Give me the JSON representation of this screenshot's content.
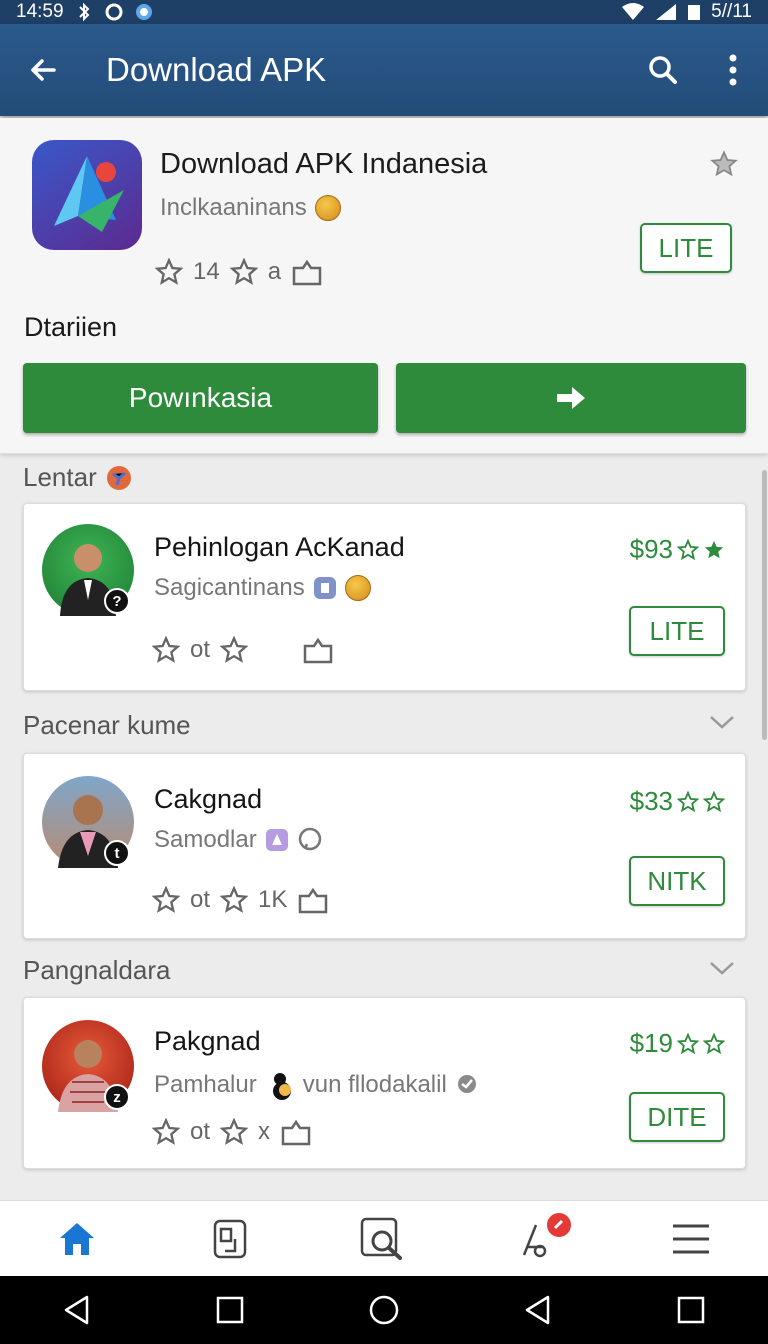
{
  "status_bar": {
    "time": "14:59",
    "right_text": "5//11"
  },
  "app_bar": {
    "title": "Download APK"
  },
  "hero": {
    "app_name": "Download APK Indanesia",
    "developer": "Inclkaaninans",
    "tag": "LITE",
    "meta": {
      "rating": "14",
      "downloads": "a"
    },
    "section_title": "Dtariien",
    "download_button": "Powınkasia"
  },
  "sections": [
    {
      "title": "Lentar"
    },
    {
      "title": "Pacenar kume"
    },
    {
      "title": "Pangnaldara"
    }
  ],
  "cards": [
    {
      "name": "Pehinlogan AcKanad",
      "developer": "Sagicantinans",
      "price": "$93",
      "tag": "LITE",
      "meta_a": "ot",
      "meta_b": "",
      "badge": "?"
    },
    {
      "name": "Cakgnad",
      "developer": "Samodlar",
      "price": "$33",
      "tag": "NITK",
      "meta_a": "ot",
      "meta_b": "1K",
      "badge": "t"
    },
    {
      "name": "Pakgnad",
      "developer": "Pamhalur",
      "developer_extra": "vun fllodakalil",
      "price": "$19",
      "tag": "DITE",
      "meta_a": "ot",
      "meta_b": "x",
      "badge": "z"
    }
  ],
  "icons": {
    "status": [
      "wifi-icon",
      "signal-icon",
      "battery-icon"
    ],
    "app_bar": [
      "back-arrow-icon",
      "search-icon",
      "more-vert-icon"
    ],
    "bottom_nav": [
      "home-icon",
      "apps-icon",
      "search-doc-icon",
      "updates-icon",
      "menu-icon"
    ],
    "system_nav": [
      "back-triangle-icon",
      "square-icon",
      "circle-icon",
      "back-triangle-icon",
      "square-icon"
    ]
  },
  "colors": {
    "primary": "#2b5a8d",
    "accent_green": "#2e8b3b",
    "home_active": "#1976d2",
    "notification": "#e53935"
  }
}
